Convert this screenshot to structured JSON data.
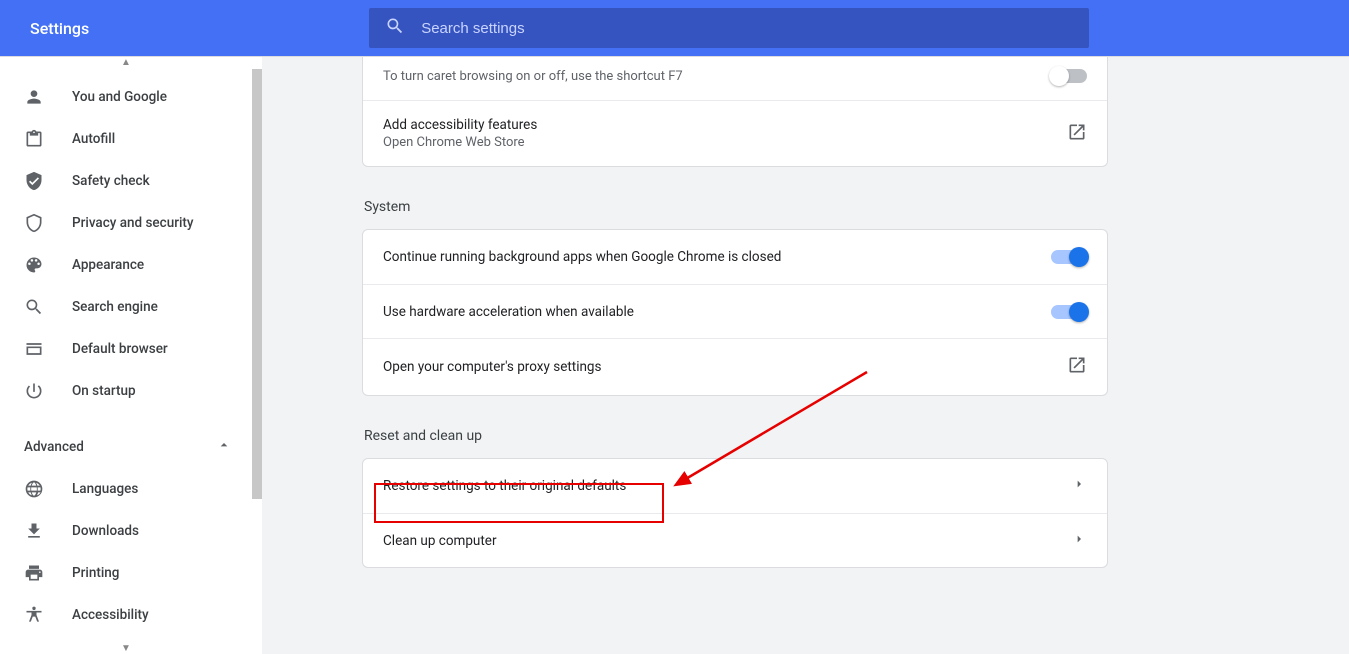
{
  "header": {
    "title": "Settings",
    "search_placeholder": "Search settings"
  },
  "sidebar": {
    "items": [
      {
        "id": "you-google",
        "label": "You and Google",
        "icon": "person"
      },
      {
        "id": "autofill",
        "label": "Autofill",
        "icon": "clipboard"
      },
      {
        "id": "safety",
        "label": "Safety check",
        "icon": "shield-check"
      },
      {
        "id": "privacy",
        "label": "Privacy and security",
        "icon": "shield"
      },
      {
        "id": "appearance",
        "label": "Appearance",
        "icon": "palette"
      },
      {
        "id": "search",
        "label": "Search engine",
        "icon": "search"
      },
      {
        "id": "default",
        "label": "Default browser",
        "icon": "browser"
      },
      {
        "id": "startup",
        "label": "On startup",
        "icon": "power"
      }
    ],
    "advanced_label": "Advanced",
    "advanced_items": [
      {
        "id": "languages",
        "label": "Languages",
        "icon": "globe"
      },
      {
        "id": "downloads",
        "label": "Downloads",
        "icon": "download"
      },
      {
        "id": "printing",
        "label": "Printing",
        "icon": "print"
      },
      {
        "id": "accessibility",
        "label": "Accessibility",
        "icon": "accessibility"
      }
    ]
  },
  "content": {
    "accessibility_card": {
      "row0_text": "To turn caret browsing on or off, use the shortcut F7",
      "row0_toggle": false,
      "row1_text": "Add accessibility features",
      "row1_sub": "Open Chrome Web Store"
    },
    "system_label": "System",
    "system_card": {
      "row0_text": "Continue running background apps when Google Chrome is closed",
      "row0_toggle": true,
      "row1_text": "Use hardware acceleration when available",
      "row1_toggle": true,
      "row2_text": "Open your computer's proxy settings"
    },
    "reset_label": "Reset and clean up",
    "reset_card": {
      "row0_text": "Restore settings to their original defaults",
      "row1_text": "Clean up computer"
    }
  }
}
